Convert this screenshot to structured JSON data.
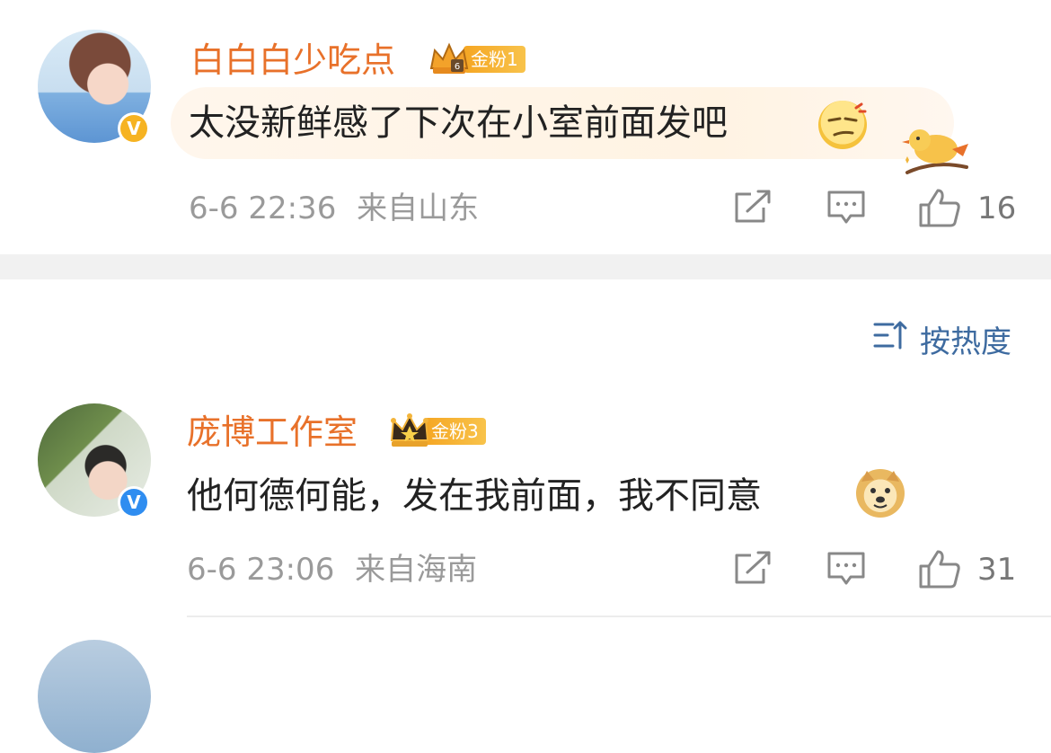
{
  "comments": [
    {
      "username": "白白白少吃点",
      "fan_badge": "金粉1",
      "text": "太没新鲜感了下次在小室前面发吧",
      "emoji": "smirk-emoji",
      "date": "6-6 22:36",
      "location": "来自山东",
      "likes": "16",
      "verified_color": "#f6b322"
    },
    {
      "username": "庞博工作室",
      "fan_badge": "金粉3",
      "text": "他何德何能，发在我前面，我不同意",
      "emoji": "doge-emoji",
      "date": "6-6 23:06",
      "location": "来自海南",
      "likes": "31",
      "verified_color": "#2f8df0"
    }
  ],
  "sort": {
    "label": "按热度"
  },
  "colors": {
    "username": "#e8712a",
    "fan_badge": "#f5a623",
    "meta": "#9a9a9a",
    "sort": "#3e6ba0"
  }
}
